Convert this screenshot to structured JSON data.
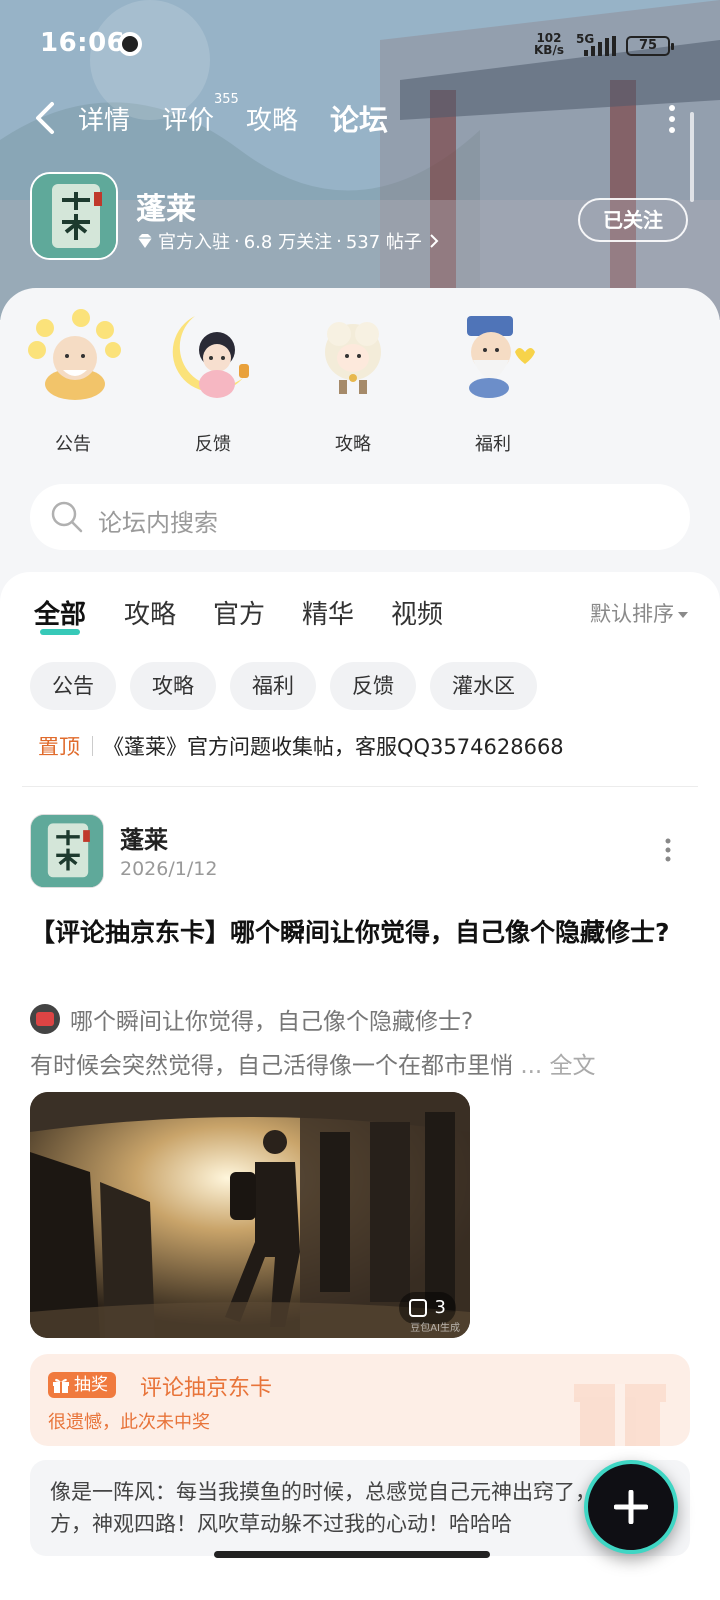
{
  "status_bar": {
    "time": "16:06",
    "net_speed_value": "102",
    "net_speed_unit": "KB/s",
    "network": "5G",
    "battery": "75"
  },
  "nav": {
    "tabs": [
      {
        "label": "详情"
      },
      {
        "label": "评价",
        "badge": "355"
      },
      {
        "label": "攻略"
      },
      {
        "label": "论坛"
      }
    ],
    "active_tab": "论坛"
  },
  "game": {
    "name": "蓬莱",
    "logo_text": "蓬莱",
    "official": "官方入驻",
    "followers": "6.8 万关注",
    "posts": "537 帖子",
    "follow_label": "已关注"
  },
  "categories": [
    {
      "label": "公告",
      "icon": "announcement-character-icon"
    },
    {
      "label": "反馈",
      "icon": "feedback-character-icon"
    },
    {
      "label": "攻略",
      "icon": "guide-sheep-icon"
    },
    {
      "label": "福利",
      "icon": "welfare-elder-icon"
    }
  ],
  "search": {
    "placeholder": "论坛内搜索"
  },
  "filter_tabs": [
    "全部",
    "攻略",
    "官方",
    "精华",
    "视频"
  ],
  "active_filter": "全部",
  "sort_label": "默认排序",
  "chips": [
    "公告",
    "攻略",
    "福利",
    "反馈",
    "灌水区"
  ],
  "pinned": {
    "label": "置顶",
    "text": "《蓬莱》官方问题收集帖，客服QQ3574628668"
  },
  "post": {
    "author": "蓬莱",
    "date": "2026/1/12",
    "title": "【评论抽京东卡】哪个瞬间让你觉得，自己像个隐藏修士?",
    "quote": "哪个瞬间让你觉得，自己像个隐藏修士?",
    "excerpt": "有时候会突然觉得，自己活得像一个在都市里悄",
    "read_more": "... 全文",
    "image_count": "3",
    "image_watermark": "豆包AI生成",
    "lottery_tag": "抽奖",
    "lottery_title": "评论抽京东卡",
    "lottery_status": "很遗憾，此次未中奖",
    "top_comment": "像是一阵风：每当我摸鱼的时候，总感觉自己元神出窍了，耳听八方，神观四路！风吹草动躲不过我的心动！哈哈哈"
  },
  "colors": {
    "accent": "#37c9b8",
    "pinned": "#e06b2c",
    "lottery": "#e8743a"
  }
}
